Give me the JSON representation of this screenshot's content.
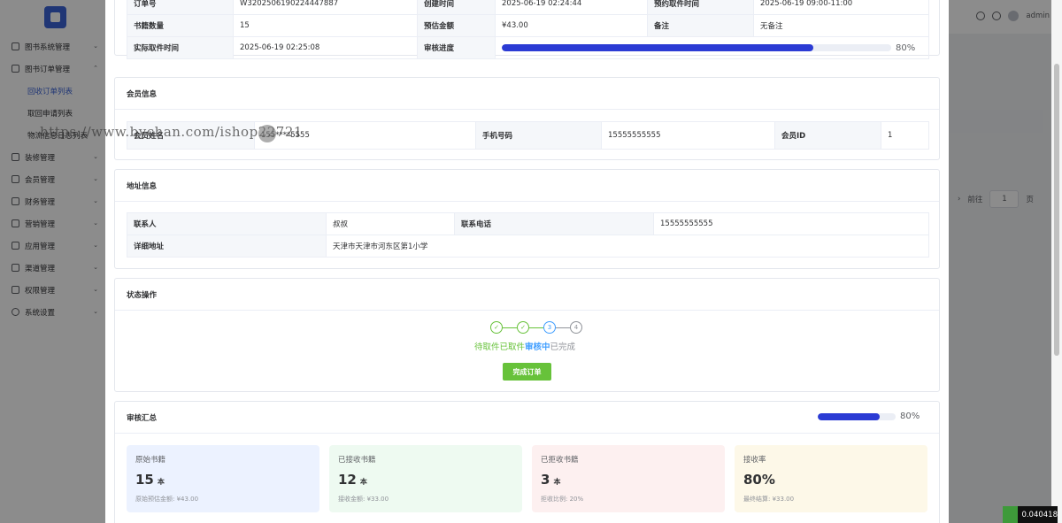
{
  "sidebar": {
    "menus": [
      {
        "label": "图书系统管理"
      },
      {
        "label": "图书订单管理"
      },
      {
        "label": "装修管理"
      },
      {
        "label": "会员管理"
      },
      {
        "label": "财务管理"
      },
      {
        "label": "营销管理"
      },
      {
        "label": "应用管理"
      },
      {
        "label": "渠道管理"
      },
      {
        "label": "权限管理"
      },
      {
        "label": "系统设置"
      }
    ],
    "submenus": [
      {
        "label": "回收订单列表"
      },
      {
        "label": "取回申请列表"
      },
      {
        "label": "物流信息日志列表"
      }
    ]
  },
  "topbar": {
    "user": "admin"
  },
  "pager": {
    "goto_label": "前往",
    "page": "1",
    "page_suffix": "页"
  },
  "order": {
    "row0": {
      "l1": "订单号",
      "v1": "W3202506190224447887",
      "l2": "创建时间",
      "v2": "2025-06-19 02:24:44",
      "l3": "预约取件时间",
      "v3": "2025-06-19 09:00-11:00"
    },
    "row1": {
      "l1": "书籍数量",
      "v1": "15",
      "l2": "预估金额",
      "v2": "¥43.00",
      "l3": "备注",
      "v3": "无备注"
    },
    "row2": {
      "l1": "实际取件时间",
      "v1": "2025-06-19 02:25:08",
      "l2": "审核进度",
      "progress": 0.8,
      "progress_text": "80%"
    }
  },
  "member": {
    "title": "会员信息",
    "l1": "会员姓名",
    "v1": "155****5555",
    "l2": "手机号码",
    "v2": "15555555555",
    "l3": "会员ID",
    "v3": "1"
  },
  "address": {
    "title": "地址信息",
    "l1": "联系人",
    "v1": "叔叔",
    "l2": "联系电话",
    "v2": "15555555555",
    "l3": "详细地址",
    "v3": "天津市天津市河东区第1小学"
  },
  "status": {
    "title": "状态操作",
    "steps": [
      {
        "label": "待取件",
        "state": "done"
      },
      {
        "label": "已取件",
        "state": "done"
      },
      {
        "label": "审核中",
        "state": "process",
        "num": "3"
      },
      {
        "label": "已完成",
        "state": "wait",
        "num": "4"
      }
    ],
    "done_mark": "✓",
    "button": "完成订单",
    "colors": {
      "done": "#67c23a",
      "process": "#409eff",
      "wait": "#909399"
    }
  },
  "summary": {
    "title": "审核汇总",
    "progress": 0.8,
    "progress_text": "80%",
    "cards": [
      {
        "label": "原始书籍",
        "value": "15",
        "unit": "本",
        "sub": "原始预估金额: ¥43.00",
        "bg": "#ecf2ff"
      },
      {
        "label": "已接收书籍",
        "value": "12",
        "unit": "本",
        "sub": "接收金额: ¥33.00",
        "bg": "#eefaf1"
      },
      {
        "label": "已拒收书籍",
        "value": "3",
        "unit": "本",
        "sub": "拒收比例: 20%",
        "bg": "#fdf0f0"
      },
      {
        "label": "接收率",
        "value": "80%",
        "unit": "",
        "sub": "最终结算: ¥33.00",
        "bg": "#fdf8e8"
      }
    ]
  },
  "watermark": "https://www.bychan.com/ishop22721",
  "fps": "0.040418"
}
